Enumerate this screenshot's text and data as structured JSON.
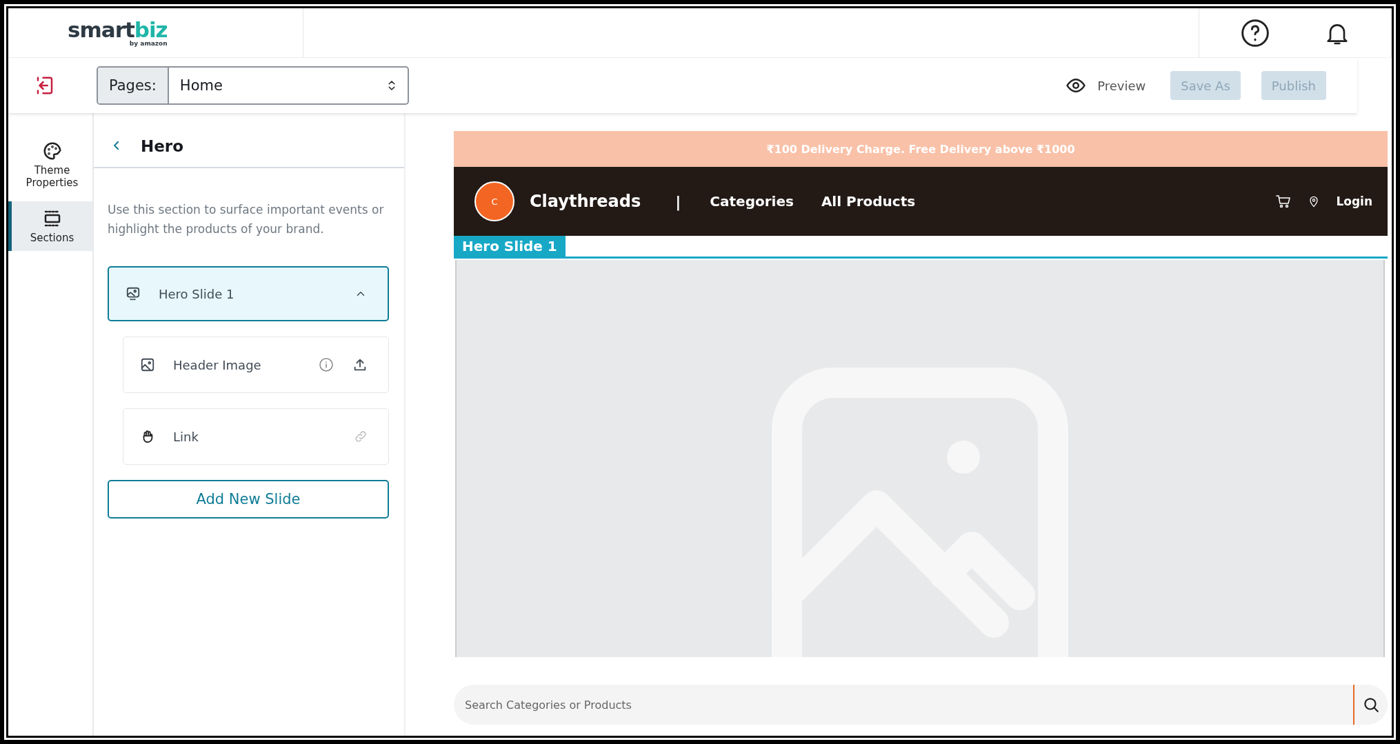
{
  "logo": {
    "word_dark": "sm",
    "word_mid": "art",
    "word_teal": "biz",
    "byline": "by amazon"
  },
  "page_select": {
    "label": "Pages:",
    "value": "Home"
  },
  "actions": [
    {
      "kind": "preview",
      "label": "Preview",
      "disabled": false
    },
    {
      "kind": "button",
      "label": "Save As",
      "disabled": true
    },
    {
      "kind": "button",
      "label": "Publish",
      "disabled": true
    }
  ],
  "rail": [
    {
      "kind": "palette",
      "label": "Theme Properties",
      "selected": false
    },
    {
      "kind": "sections",
      "label": "Sections",
      "selected": true
    }
  ],
  "panel": {
    "title": "Hero",
    "description": "Use this section to surface important events or highlight the products of your brand.",
    "slides": [
      {
        "title": "Hero Slide 1",
        "expanded": true,
        "fields": [
          {
            "kind": "image",
            "label": "Header Image"
          },
          {
            "kind": "link",
            "label": "Link"
          }
        ]
      }
    ],
    "add_button": "Add New Slide"
  },
  "preview": {
    "banner": "₹100 Delivery Charge. Free Delivery above ₹1000",
    "avatar": "C",
    "store_name": "Claythreads",
    "separator": "|",
    "nav": [
      "Categories",
      "All Products"
    ],
    "login": "Login",
    "hero_tag": "Hero Slide 1",
    "search_placeholder": "Search Categories or Products"
  }
}
